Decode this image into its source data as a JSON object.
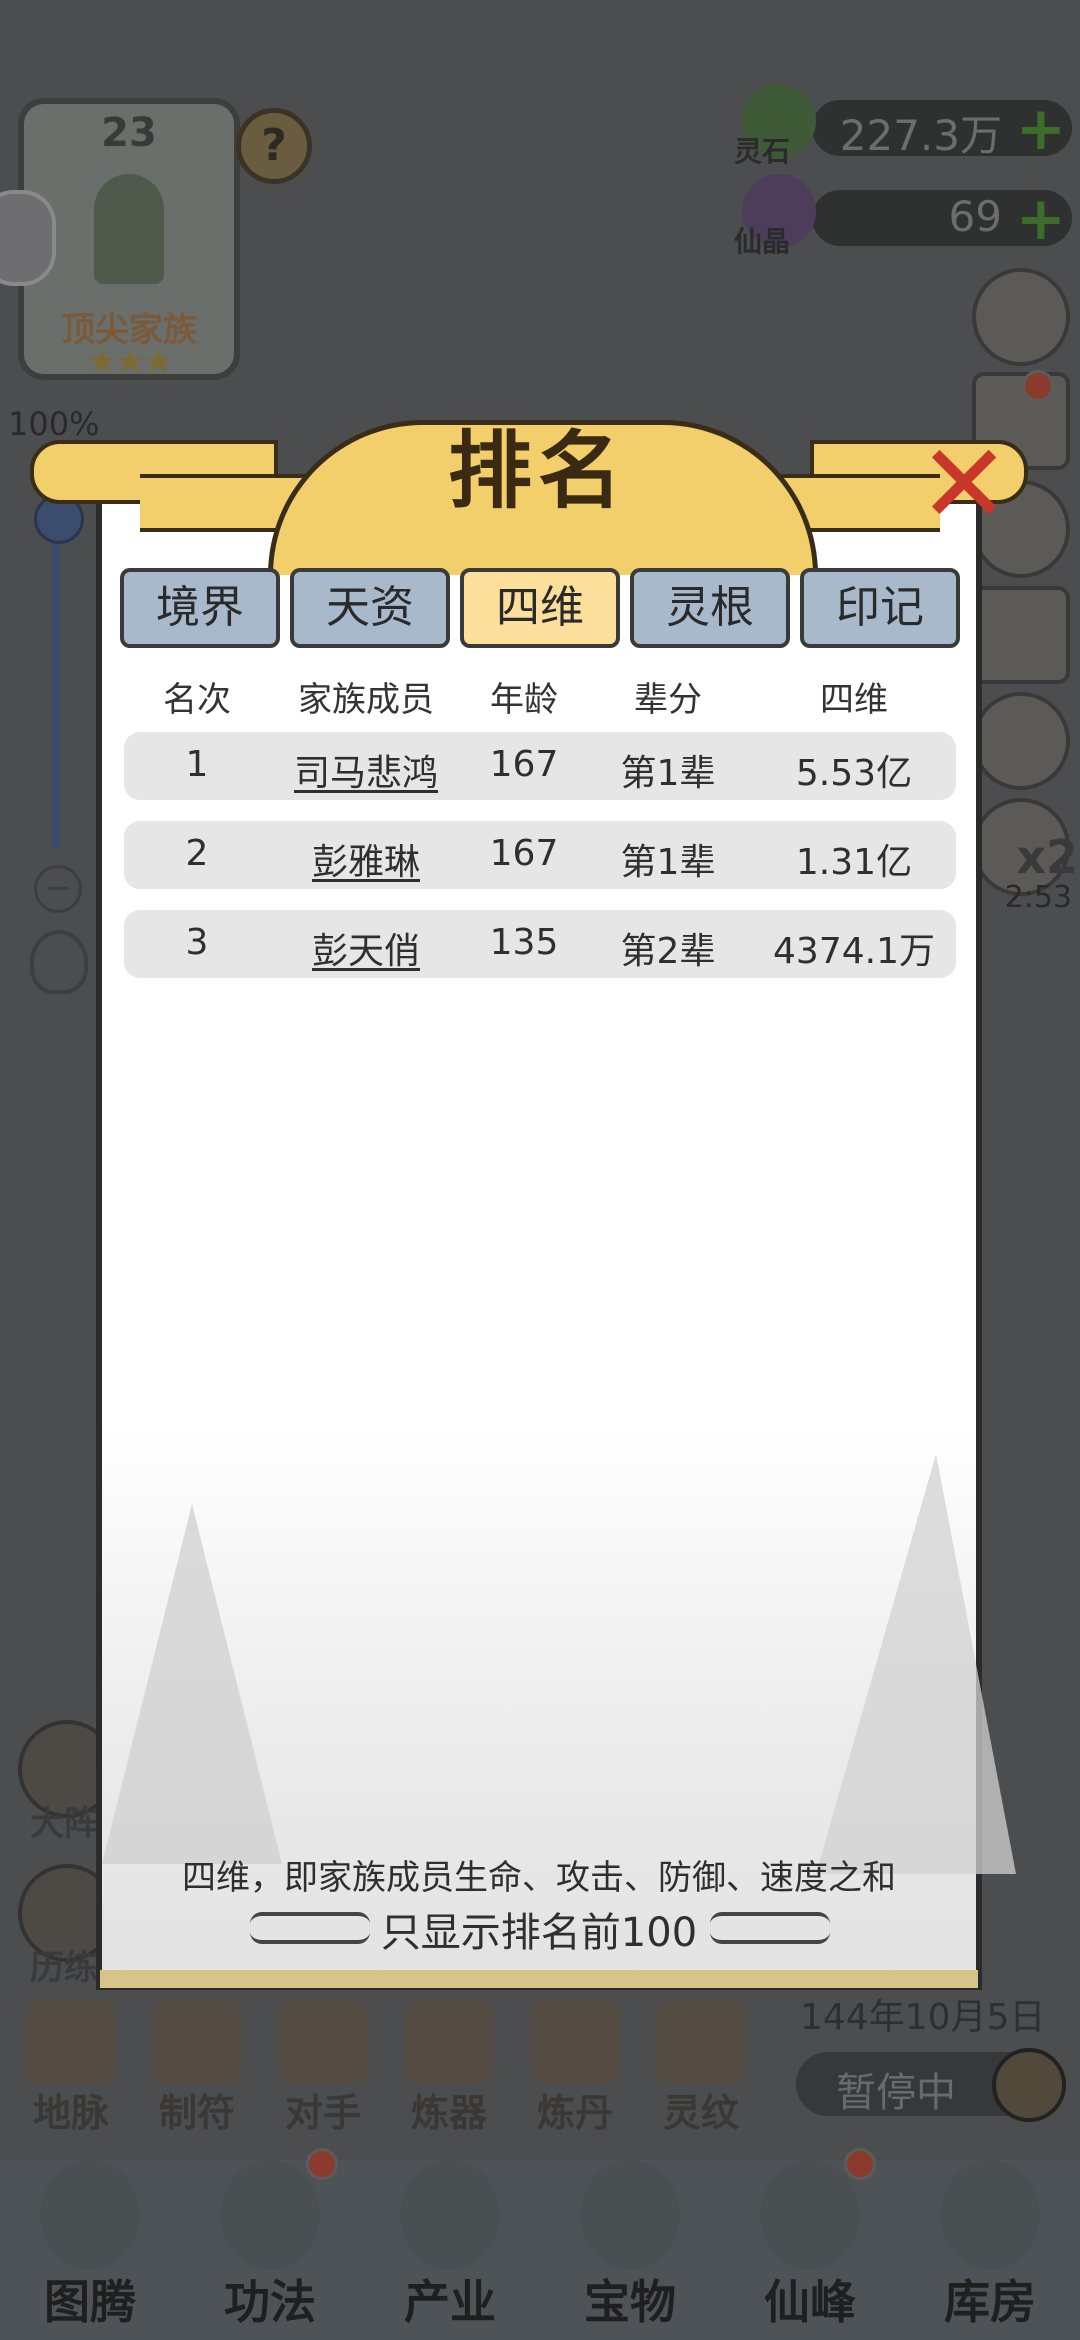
{
  "hud": {
    "family_level": "23",
    "family_name": "顶尖家族",
    "stars": "★★★",
    "help": "?",
    "zoom_percent": "100%",
    "zoom_plus": "+",
    "zoom_minus": "−",
    "resources": [
      {
        "label": "灵石",
        "value": "227.3万",
        "color": "#3c6d2a"
      },
      {
        "label": "仙晶",
        "value": "69",
        "color": "#5a3f6e"
      }
    ],
    "speed_multiplier": "x2",
    "speed_timer": "2:53",
    "left_actions": [
      "大阵",
      "历练"
    ],
    "date": "144年10月5日",
    "pause_label": "暂停中",
    "skills": [
      "地脉",
      "制符",
      "对手",
      "炼器",
      "炼丹",
      "灵纹"
    ],
    "bottom_nav": [
      "图腾",
      "功法",
      "产业",
      "宝物",
      "仙峰",
      "库房"
    ]
  },
  "modal": {
    "title": "排名",
    "tabs": [
      {
        "label": "境界",
        "active": false
      },
      {
        "label": "天资",
        "active": false
      },
      {
        "label": "四维",
        "active": true
      },
      {
        "label": "灵根",
        "active": false
      },
      {
        "label": "印记",
        "active": false
      }
    ],
    "columns": [
      "名次",
      "家族成员",
      "年龄",
      "辈分",
      "四维"
    ],
    "rows": [
      {
        "rank": "1",
        "name": "司马悲鸿",
        "age": "167",
        "generation": "第1辈",
        "stat": "5.53亿"
      },
      {
        "rank": "2",
        "name": "彭雅琳",
        "age": "167",
        "generation": "第1辈",
        "stat": "1.31亿"
      },
      {
        "rank": "3",
        "name": "彭天俏",
        "age": "135",
        "generation": "第2辈",
        "stat": "4374.1万"
      }
    ],
    "footnote": "四维，即家族成员生命、攻击、防御、速度之和",
    "limit_note": "只显示排名前100"
  },
  "colors": {
    "title_gold": "#f2cf6a",
    "active_tab": "#fbdf9a",
    "inactive_tab": "#a9b9cc",
    "close_red": "#c9372b"
  }
}
